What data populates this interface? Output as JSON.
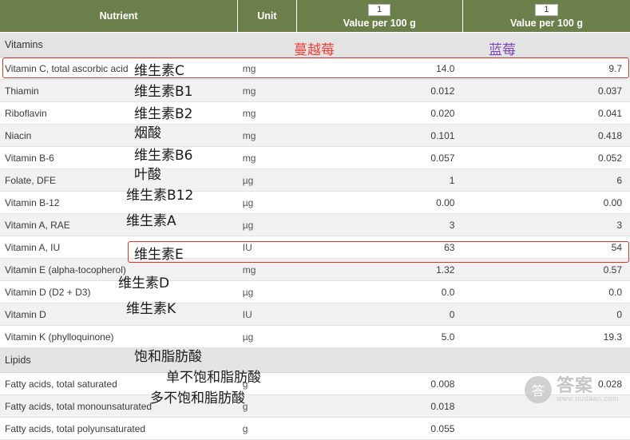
{
  "table": {
    "headers": {
      "nutrient": "Nutrient",
      "unit": "Unit",
      "value1_num": "1",
      "value1": "Value per 100 g",
      "value2_num": "1",
      "value2": "Value per 100 g"
    },
    "sections": [
      {
        "title": "Vitamins",
        "rows": [
          {
            "name": "Vitamin C, total ascorbic acid",
            "unit": "mg",
            "v1": "14.0",
            "v2": "9.7"
          },
          {
            "name": "Thiamin",
            "unit": "mg",
            "v1": "0.012",
            "v2": "0.037"
          },
          {
            "name": "Riboflavin",
            "unit": "mg",
            "v1": "0.020",
            "v2": "0.041"
          },
          {
            "name": "Niacin",
            "unit": "mg",
            "v1": "0.101",
            "v2": "0.418"
          },
          {
            "name": "Vitamin B-6",
            "unit": "mg",
            "v1": "0.057",
            "v2": "0.052"
          },
          {
            "name": "Folate, DFE",
            "unit": "µg",
            "v1": "1",
            "v2": "6"
          },
          {
            "name": "Vitamin B-12",
            "unit": "µg",
            "v1": "0.00",
            "v2": "0.00"
          },
          {
            "name": "Vitamin A, RAE",
            "unit": "µg",
            "v1": "3",
            "v2": "3"
          },
          {
            "name": "Vitamin A, IU",
            "unit": "IU",
            "v1": "63",
            "v2": "54"
          },
          {
            "name": "Vitamin E (alpha-tocopherol)",
            "unit": "mg",
            "v1": "1.32",
            "v2": "0.57"
          },
          {
            "name": "Vitamin D (D2 + D3)",
            "unit": "µg",
            "v1": "0.0",
            "v2": "0.0"
          },
          {
            "name": "Vitamin D",
            "unit": "IU",
            "v1": "0",
            "v2": "0"
          },
          {
            "name": "Vitamin K (phylloquinone)",
            "unit": "µg",
            "v1": "5.0",
            "v2": "19.3"
          }
        ]
      },
      {
        "title": "Lipids",
        "rows": [
          {
            "name": "Fatty acids, total saturated",
            "unit": "g",
            "v1": "0.008",
            "v2": "0.028"
          },
          {
            "name": "Fatty acids, total monounsaturated",
            "unit": "g",
            "v1": "0.018",
            "v2": ""
          },
          {
            "name": "Fatty acids, total polyunsaturated",
            "unit": "g",
            "v1": "0.055",
            "v2": ""
          }
        ]
      }
    ]
  },
  "annotations": {
    "col1_label": "蔓越莓",
    "col2_label": "蓝莓",
    "vitamin_c": "维生素C",
    "vitamin_b1": "维生素B1",
    "vitamin_b2": "维生素B2",
    "niacin": "烟酸",
    "vitamin_b6": "维生素B6",
    "folate": "叶酸",
    "vitamin_b12": "维生素B12",
    "vitamin_a": "维生素A",
    "vitamin_e": "维生素E",
    "vitamin_d": "维生素D",
    "vitamin_k": "维生素K",
    "saturated": "饱和脂肪酸",
    "monounsaturated": "单不饱和脂肪酸",
    "polyunsaturated": "多不饱和脂肪酸"
  },
  "watermark": {
    "logo_glyph": "答",
    "main": "答案",
    "sub": "www.nudaan.com"
  },
  "colors": {
    "header_green": "#6b7f4b",
    "annotation_red": "#e8403a",
    "annotation_purple": "#7b46b5",
    "highlight_box": "#e0322c"
  }
}
